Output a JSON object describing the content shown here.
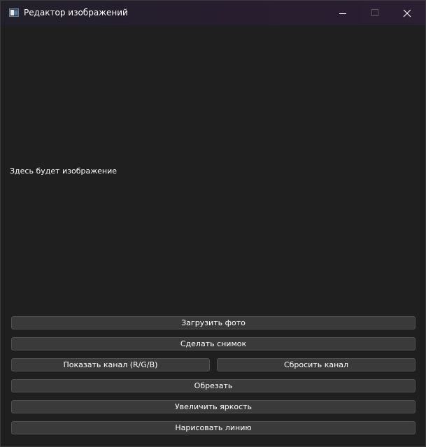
{
  "window": {
    "title": "Редактор изображений",
    "app_icon": "image-app-icon",
    "controls": [
      "minimize-icon",
      "maximize-icon",
      "close-icon"
    ]
  },
  "main": {
    "image_placeholder": "Здесь будет изображение"
  },
  "buttons": {
    "load_photo": "Загрузить фото",
    "take_snapshot": "Сделать снимок",
    "show_channel": "Показать канал (R/G/B)",
    "reset_channel": "Сбросить канал",
    "crop": "Обрезать",
    "increase_brightness": "Увеличить яркость",
    "draw_line": "Нарисовать линию"
  },
  "colors": {
    "background": "#1f1f1f",
    "button": "#3a3a3a",
    "button_border": "#505050",
    "titlebar": "#271d2e",
    "text": "#ffffff"
  }
}
